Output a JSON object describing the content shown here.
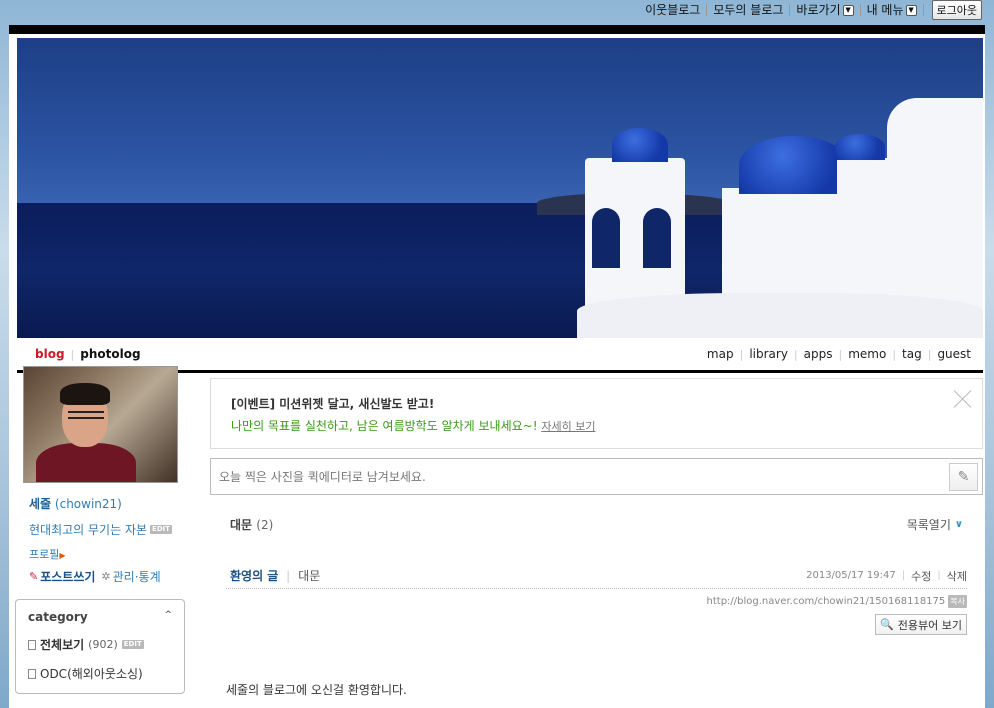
{
  "topbar": {
    "neighbor_blog": "이웃블로그",
    "all_blog": "모두의 블로그",
    "shortcut": "바로가기",
    "my_menu": "내 메뉴",
    "logout": "로그아웃"
  },
  "nav": {
    "blog": "blog",
    "photolog": "photolog",
    "items": [
      "map",
      "library",
      "apps",
      "memo",
      "tag",
      "guest"
    ],
    "active_color": "#cc1a2b"
  },
  "profile": {
    "nick": "세줄",
    "id": "(chowin21)",
    "motto": "현대최고의 무기는 자본",
    "edit": "EDIT",
    "profile_link": "프로필",
    "write_post": "포스트쓰기",
    "manage": "관리·통계"
  },
  "category": {
    "title": "category",
    "items": [
      {
        "label": "전체보기",
        "count": "(902)"
      },
      {
        "label": "ODC(해외아웃소싱)",
        "count": ""
      }
    ]
  },
  "event": {
    "title": "[이벤트] 미션위젯 달고, 새신발도 받고!",
    "desc": "나만의 목표를 실천하고, 남은 여름방학도 알차게 보내세요~!",
    "link": "자세히 보기"
  },
  "quick_editor": {
    "placeholder": "오늘 찍은 사진을 퀵에디터로 남겨보세요."
  },
  "list_header": {
    "category": "대문",
    "count": "(2)",
    "toggle": "목록열기"
  },
  "post": {
    "title": "환영의 글",
    "category": "대문",
    "date": "2013/05/17 19:47",
    "edit": "수정",
    "delete": "삭제",
    "url": "http://blog.naver.com/chowin21/150168118175",
    "copy": "복사",
    "viewer": "전용뷰어 보기",
    "body": "세줄의 블로그에 오신걸 환영합니다."
  }
}
